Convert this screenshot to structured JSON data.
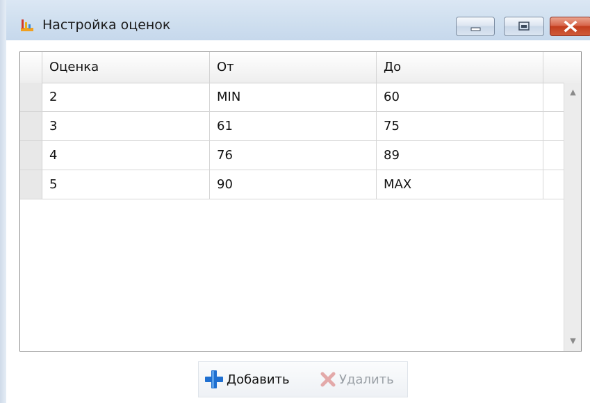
{
  "window": {
    "title": "Настройка оценок",
    "controls": [
      "minimize",
      "maximize",
      "close"
    ]
  },
  "grid": {
    "columns": [
      "Оценка",
      "От",
      "До"
    ],
    "rows": [
      [
        "2",
        "MIN",
        "60"
      ],
      [
        "3",
        "61",
        "75"
      ],
      [
        "4",
        "76",
        "89"
      ],
      [
        "5",
        "90",
        "MAX"
      ]
    ]
  },
  "toolbar": {
    "add_label": "Добавить",
    "delete_label": "Удалить"
  },
  "colors": {
    "add_icon": "#1f6fd0",
    "delete_icon": "#e3a9a9",
    "close_button": "#c94a2c"
  }
}
